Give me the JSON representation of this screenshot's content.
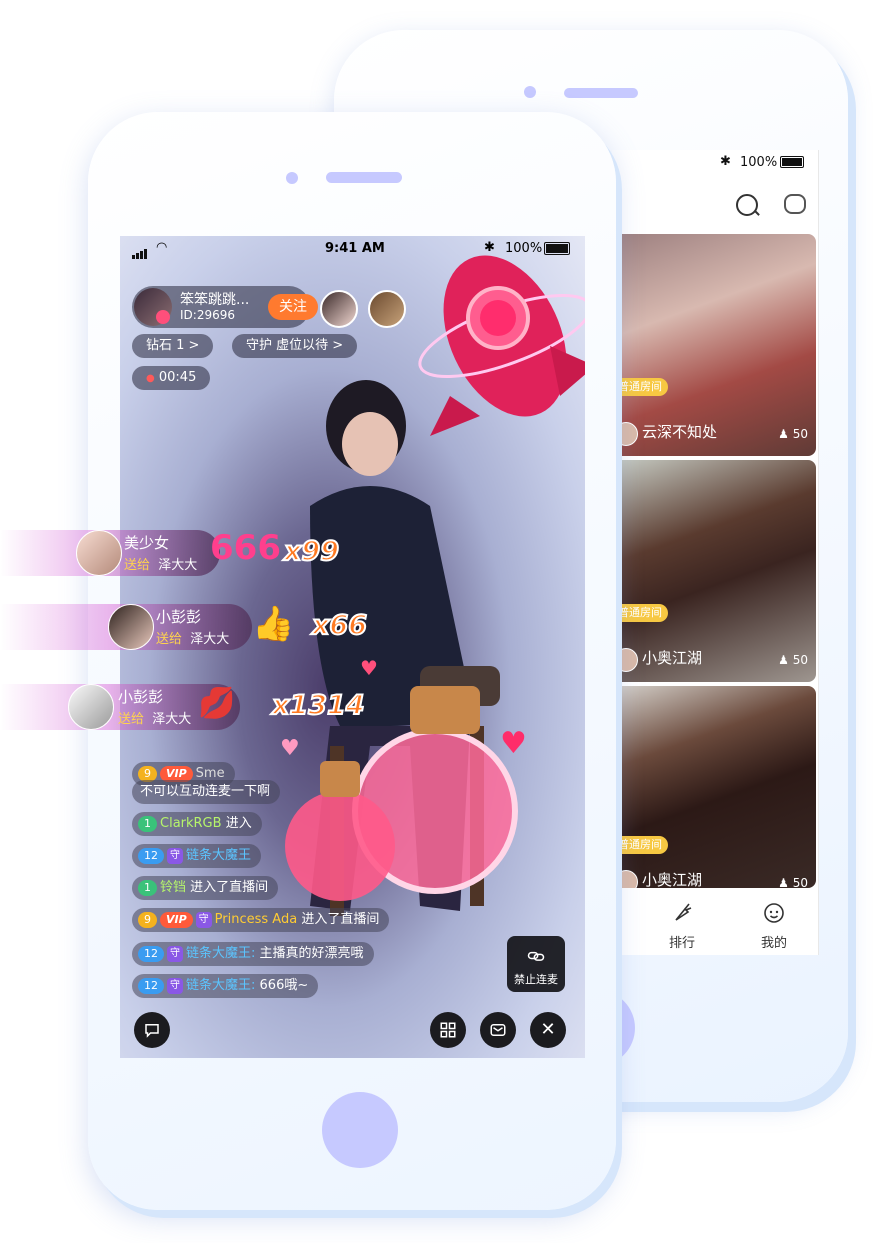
{
  "back_phone": {
    "status": {
      "battery_pct": "100%"
    },
    "cards": [
      {
        "tag": "普通房间",
        "name": "云深不知处",
        "count": "50"
      },
      {
        "tag": "普通房间",
        "name": "小奥江湖",
        "count": "50"
      },
      {
        "tag": "普通房间",
        "name": "小奥江湖",
        "count": "50"
      }
    ],
    "tabbar": {
      "rank": "排行",
      "mine": "我的"
    }
  },
  "front_phone": {
    "status": {
      "time": "9:41 AM",
      "battery_pct": "100%"
    },
    "host": {
      "name": "笨笨跳跳...",
      "id": "ID:29696",
      "follow": "关注"
    },
    "diamond": "钻石 1 >",
    "guard": "守护 虚位以待 >",
    "live_timer": "00:45",
    "gifts": [
      {
        "user": "美少女",
        "sent": "送给",
        "target": "泽大大",
        "combo": "x99"
      },
      {
        "user": "小彭彭",
        "sent": "送给",
        "target": "泽大大",
        "combo": "x66"
      },
      {
        "user": "小彭彭",
        "sent": "送给",
        "target": "泽大大",
        "combo": "x1314"
      }
    ],
    "chat": [
      {
        "level": "9",
        "vip": "VIP",
        "name": "Sme",
        "text": "",
        "badge": "yellow"
      },
      {
        "text_line": "不可以互动连麦一下啊"
      },
      {
        "level": "1",
        "name": "ClarkRGB",
        "text": "进入",
        "badge": "green"
      },
      {
        "level": "12",
        "guard": "守",
        "name": "链条大魔王",
        "text": "",
        "badge": "blue"
      },
      {
        "level": "1",
        "name": "铃铛",
        "text": "进入了直播间",
        "badge": "green"
      },
      {
        "level": "9",
        "vip": "VIP",
        "guard": "守",
        "name": "Princess Ada",
        "text": "进入了直播间",
        "badge": "yellow"
      },
      {
        "level": "12",
        "guard": "守",
        "name": "链条大魔王:",
        "text": "主播真的好漂亮哦",
        "badge": "blue"
      },
      {
        "level": "12",
        "guard": "守",
        "name": "链条大魔王:",
        "text": "666哦~",
        "badge": "blue"
      }
    ],
    "ban_button": "禁止连麦",
    "icons": {
      "chat": "chat-bubble-icon",
      "grid": "grid-icon",
      "mail": "mail-icon",
      "close": "close-icon"
    }
  }
}
